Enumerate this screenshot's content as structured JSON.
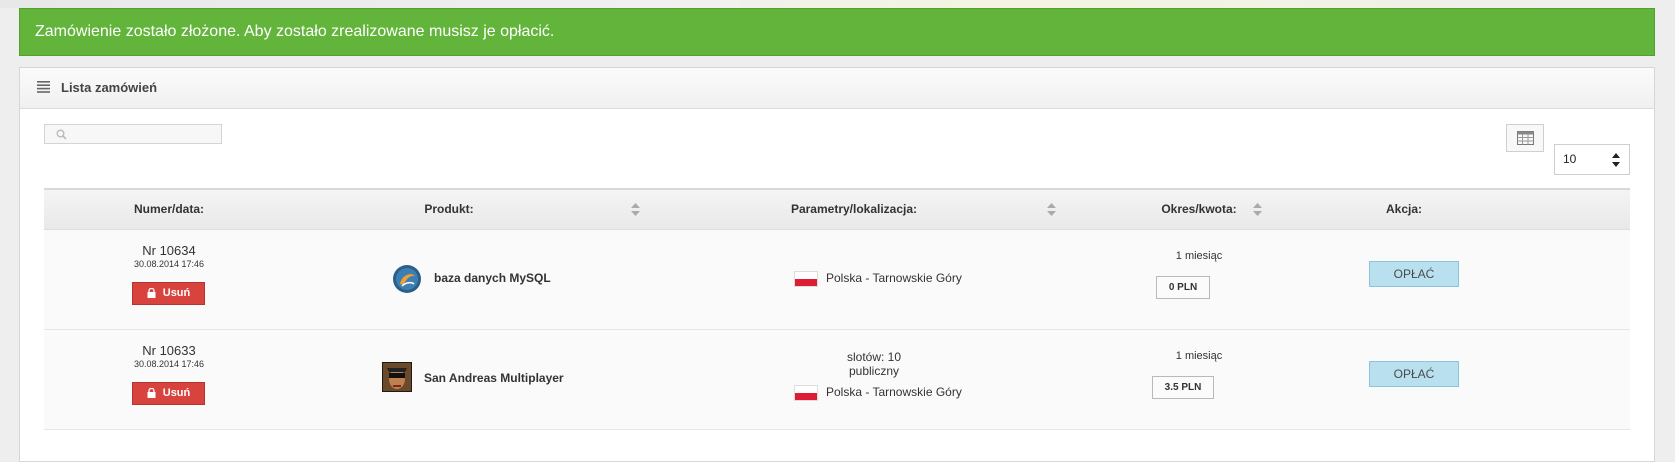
{
  "alert": {
    "message": "Zamówienie zostało złożone. Aby zostało zrealizowane musisz je opłacić."
  },
  "panel": {
    "title": "Lista zamówień",
    "search": {
      "placeholder": ""
    },
    "page_size": "10"
  },
  "table": {
    "headers": {
      "number": "Numer/data:",
      "product": "Produkt:",
      "params": "Parametry/lokalizacja:",
      "period": "Okres/kwota:",
      "action": "Akcja:"
    },
    "rows": [
      {
        "number": "Nr 10634",
        "date": "30.08.2014 17:46",
        "delete_label": "Usuń",
        "product": "baza danych MySQL",
        "product_icon": "mysql-icon",
        "params": [],
        "location": "Polska - Tarnowskie Góry",
        "period": "1 miesiąc",
        "price": "0 PLN",
        "pay_label": "OPŁAĆ"
      },
      {
        "number": "Nr 10633",
        "date": "30.08.2014 17:46",
        "delete_label": "Usuń",
        "product": "San Andreas Multiplayer",
        "product_icon": "samp-icon",
        "params": [
          "slotów: 10",
          "publiczny"
        ],
        "location": "Polska - Tarnowskie Góry",
        "period": "1 miesiąc",
        "price": "3.5 PLN",
        "pay_label": "OPŁAĆ"
      }
    ]
  },
  "colors": {
    "alert_bg": "#62b53a",
    "delete_bg": "#d9433e",
    "pay_bg": "#b8e0ef",
    "flag_red": "#dc1e35"
  }
}
